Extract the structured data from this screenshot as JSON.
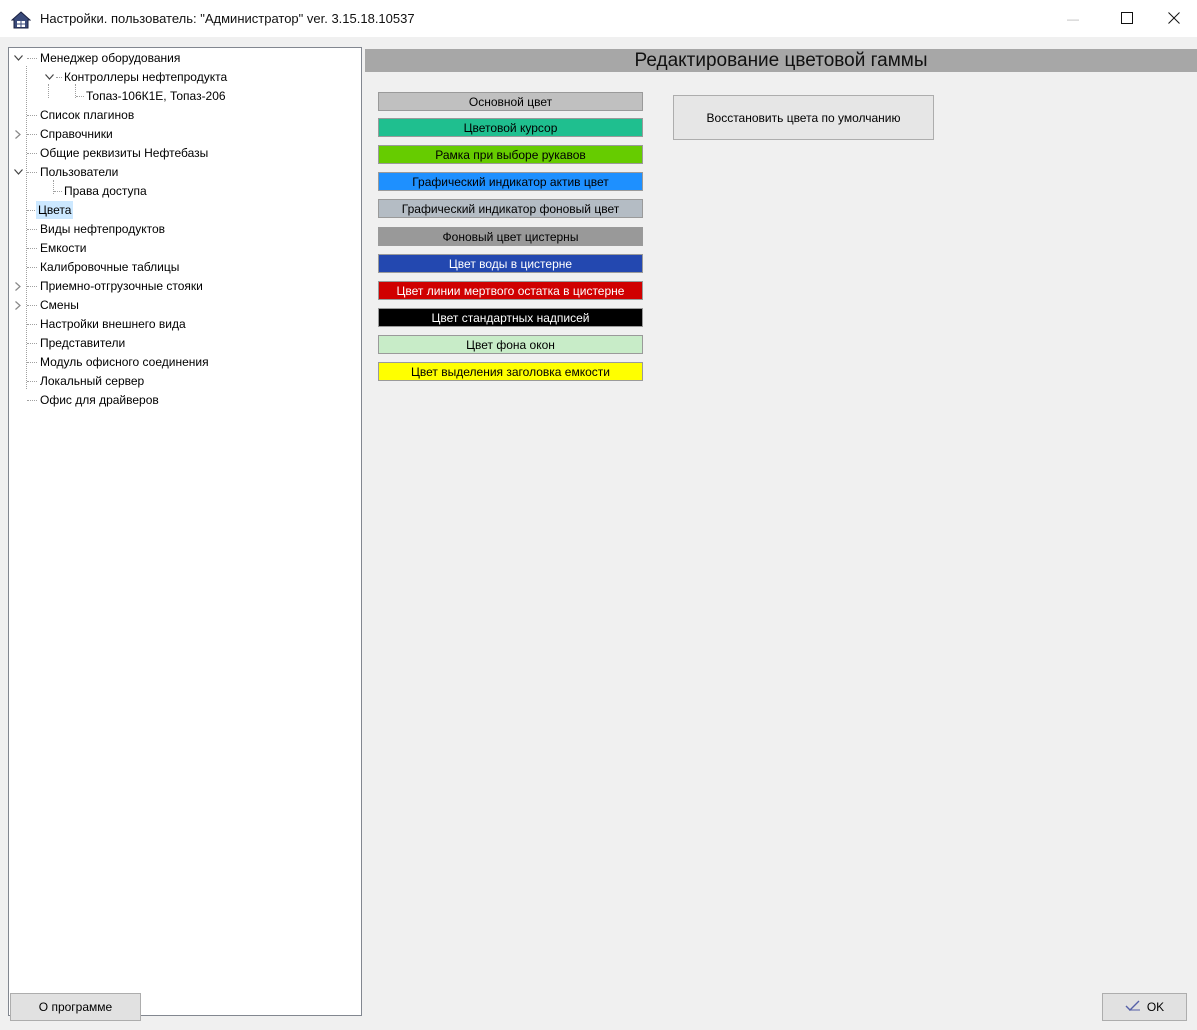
{
  "window": {
    "title": "Настройки. пользователь: \"Администратор\" ver. 3.15.18.10537",
    "minimize_symbol": "—",
    "maximize_symbol": "☐",
    "close_symbol": "✕"
  },
  "tree": {
    "items": [
      {
        "label": "Менеджер оборудования"
      },
      {
        "label": "Контроллеры нефтепродукта"
      },
      {
        "label": "Топаз-106К1Е, Топаз-206"
      },
      {
        "label": "Список плагинов"
      },
      {
        "label": "Справочники"
      },
      {
        "label": "Общие реквизиты Нефтебазы"
      },
      {
        "label": "Пользователи"
      },
      {
        "label": "Права доступа"
      },
      {
        "label": "Цвета"
      },
      {
        "label": "Виды нефтепродуктов"
      },
      {
        "label": "Емкости"
      },
      {
        "label": "Калибровочные таблицы"
      },
      {
        "label": "Приемно-отгрузочные стояки"
      },
      {
        "label": "Смены"
      },
      {
        "label": "Настройки внешнего вида"
      },
      {
        "label": "Представители"
      },
      {
        "label": "Модуль офисного соединения"
      },
      {
        "label": "Локальный сервер"
      },
      {
        "label": "Офис для драйверов"
      }
    ]
  },
  "panel": {
    "header": "Редактирование цветовой гаммы",
    "restore_button": "Восстановить цвета по умолчанию",
    "swatches": [
      {
        "label": "Основной цвет",
        "bg": "#c0c0c0",
        "fg": "#000000"
      },
      {
        "label": "Цветовой курсор",
        "bg": "#1fbf8f",
        "fg": "#000000"
      },
      {
        "label": "Рамка при выборе рукавов",
        "bg": "#66cc00",
        "fg": "#000000"
      },
      {
        "label": "Графический индикатор актив цвет",
        "bg": "#1e90ff",
        "fg": "#000000"
      },
      {
        "label": "Графический индикатор фоновый цвет",
        "bg": "#b4bcc4",
        "fg": "#000000"
      },
      {
        "label": "Фоновый цвет цистерны",
        "bg": "#999999",
        "fg": "#000000"
      },
      {
        "label": "Цвет воды в цистерне",
        "bg": "#2348b0",
        "fg": "#ffffff"
      },
      {
        "label": "Цвет линии мертвого остатка в цистерне",
        "bg": "#d00000",
        "fg": "#ffffff"
      },
      {
        "label": "Цвет стандартных надписей",
        "bg": "#000000",
        "fg": "#ffffff"
      },
      {
        "label": "Цвет фона окон",
        "bg": "#c8ecc8",
        "fg": "#000000"
      },
      {
        "label": "Цвет выделения заголовка емкости",
        "bg": "#ffff00",
        "fg": "#000000"
      }
    ]
  },
  "footer": {
    "about_button": "О программе",
    "ok_button": "OK"
  }
}
